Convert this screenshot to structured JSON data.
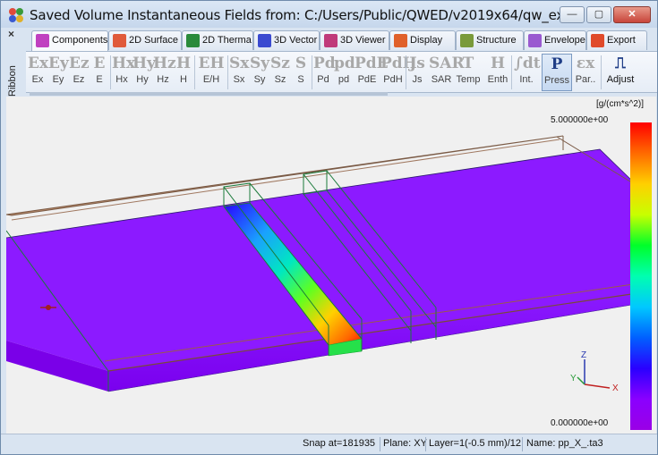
{
  "window": {
    "title": "Saved Volume Instantaneous Fields from: C:/Users/Public/QWED/v2019x64/qw_ex...",
    "minimize_glyph": "—",
    "maximize_glyph": "▢",
    "close_glyph": "✕"
  },
  "side": {
    "close_glyph": "×",
    "ribbon_label": "Ribbon"
  },
  "tabs": [
    {
      "label": "Components",
      "icon": "components-icon",
      "color": "#c040c0"
    },
    {
      "label": "2D Surface",
      "icon": "surface-icon",
      "color": "#e05a3a"
    },
    {
      "label": "2D Therma",
      "icon": "thermal-icon",
      "color": "#2a8a3a"
    },
    {
      "label": "3D Vector",
      "icon": "vector-icon",
      "color": "#3a4ad0"
    },
    {
      "label": "3D Viewer",
      "icon": "viewer-icon",
      "color": "#c03a7a"
    },
    {
      "label": "Display",
      "icon": "display-icon",
      "color": "#e0602a"
    },
    {
      "label": "Structure",
      "icon": "structure-icon",
      "color": "#7a9a3a"
    },
    {
      "label": "Envelope",
      "icon": "envelope-icon",
      "color": "#9a5ad0"
    },
    {
      "label": "Export",
      "icon": "export-icon",
      "color": "#e04a2a"
    }
  ],
  "ribbon": [
    {
      "glyph": "Ex",
      "label": "Ex"
    },
    {
      "glyph": "Ey",
      "label": "Ey"
    },
    {
      "glyph": "Ez",
      "label": "Ez"
    },
    {
      "glyph": "E",
      "label": "E"
    },
    {
      "glyph": "Hx",
      "label": "Hx"
    },
    {
      "glyph": "Hy",
      "label": "Hy"
    },
    {
      "glyph": "Hz",
      "label": "Hz"
    },
    {
      "glyph": "H",
      "label": "H"
    },
    {
      "glyph": "EH",
      "label": "E/H"
    },
    {
      "glyph": "Sx",
      "label": "Sx"
    },
    {
      "glyph": "Sy",
      "label": "Sy"
    },
    {
      "glyph": "Sz",
      "label": "Sz"
    },
    {
      "glyph": "S",
      "label": "S"
    },
    {
      "glyph": "Pd",
      "label": "Pd"
    },
    {
      "glyph": "pd",
      "label": "pd"
    },
    {
      "glyph": "PdE",
      "label": "PdE"
    },
    {
      "glyph": "PdH",
      "label": "PdH"
    },
    {
      "glyph": "Js",
      "label": "Js"
    },
    {
      "glyph": "SAR",
      "label": "SAR"
    },
    {
      "glyph": "T",
      "label": "Temp"
    },
    {
      "glyph": "H",
      "label": "Enth"
    },
    {
      "glyph": "∫dt",
      "label": "Int."
    },
    {
      "glyph": "P",
      "label": "Press"
    },
    {
      "glyph": "εx",
      "label": "Par.."
    },
    {
      "glyph": "⎍",
      "label": "Adjust"
    }
  ],
  "colorbar": {
    "unit": "[g/(cm*s^2)]",
    "max_label": "5.000000e+00",
    "min_label": "0.000000e+00",
    "colors": [
      "#ff0000",
      "#ffd000",
      "#00ff2a",
      "#00c8ff",
      "#2a00ff",
      "#9a00e6"
    ]
  },
  "axes": {
    "x": "X",
    "y": "Y",
    "z": "Z"
  },
  "status": {
    "snap": "Snap at=181935",
    "plane": "Plane: XY",
    "layer": "Layer=1(-0.5 mm)/12",
    "name": "Name: pp_X_.ta3"
  }
}
